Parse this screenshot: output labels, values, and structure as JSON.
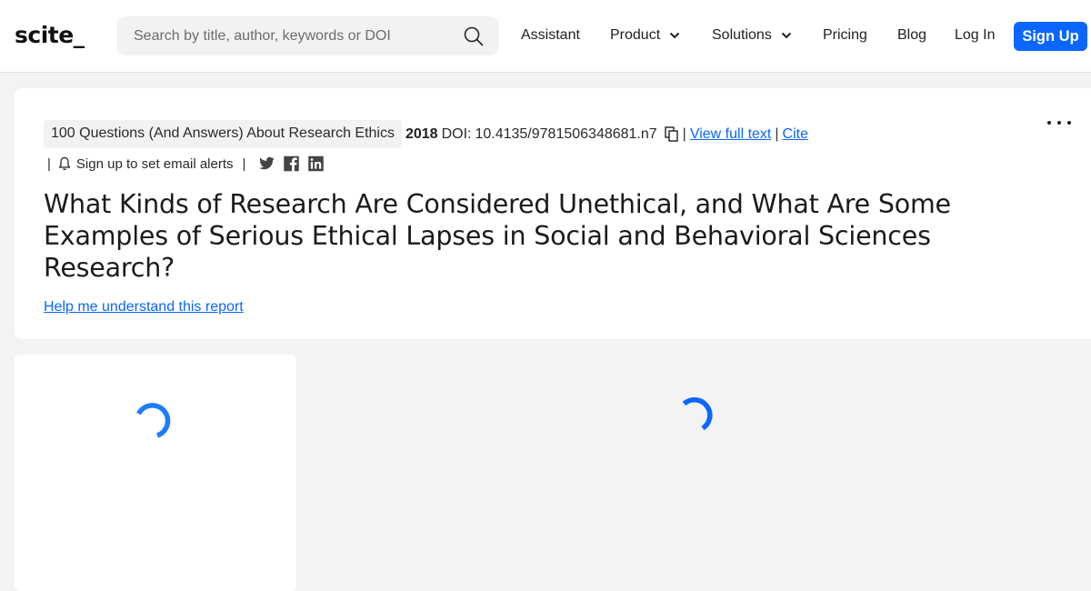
{
  "header": {
    "logo": "scite_",
    "search": {
      "placeholder": "Search by title, author, keywords or DOI",
      "value": ""
    },
    "nav": [
      {
        "label": "Assistant",
        "has_dropdown": false
      },
      {
        "label": "Product",
        "has_dropdown": true
      },
      {
        "label": "Solutions",
        "has_dropdown": true
      },
      {
        "label": "Pricing",
        "has_dropdown": false
      },
      {
        "label": "Blog",
        "has_dropdown": false
      },
      {
        "label": "Log In",
        "has_dropdown": false
      }
    ],
    "signup_label": "Sign Up",
    "accent_color": "#0a66ff"
  },
  "report": {
    "journal": "100 Questions (And Answers) About Research Ethics",
    "year": "2018",
    "doi_label": "DOI:",
    "doi": "10.4135/9781506348681.n7",
    "view_full_text": "View full text",
    "cite": "Cite",
    "separator": "|",
    "email_alerts": "Sign up to set email alerts",
    "social": [
      "twitter-icon",
      "facebook-icon",
      "linkedin-icon"
    ],
    "title": "What Kinds of Research Are Considered Unethical, and What Are Some Examples of Serious Ethical Lapses in Social and Behavioral Sciences Research?",
    "help_link": "Help me understand this report"
  },
  "loading": {
    "side_panel": "loading",
    "main_panel": "loading"
  }
}
